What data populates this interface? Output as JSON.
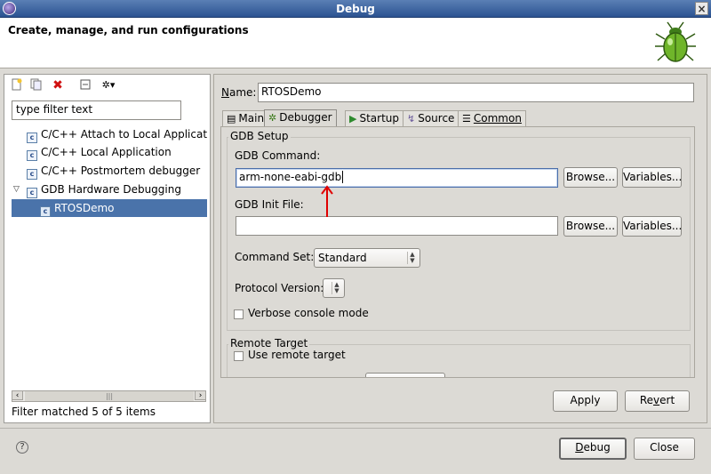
{
  "window": {
    "title": "Debug"
  },
  "banner": {
    "heading": "Create, manage, and run configurations"
  },
  "left": {
    "toolbar": [
      "new-config-icon",
      "duplicate-icon",
      "delete-icon",
      "collapse-all-icon",
      "filter-icon"
    ],
    "filter_value": "type filter text",
    "tree": [
      {
        "label": "C/C++ Attach to Local Applicatio",
        "level": 1
      },
      {
        "label": "C/C++ Local Application",
        "level": 1
      },
      {
        "label": "C/C++ Postmortem debugger",
        "level": 1
      },
      {
        "label": "GDB Hardware Debugging",
        "level": 1,
        "expanded": true
      },
      {
        "label": "RTOSDemo",
        "level": 2,
        "selected": true
      }
    ],
    "icon_letter": "c",
    "filter_status": "Filter matched 5 of 5 items"
  },
  "right": {
    "name_label_first": "N",
    "name_label_rest": "ame:",
    "name_value": "RTOSDemo",
    "tabs": [
      {
        "label": "Main",
        "icon": "▤"
      },
      {
        "label": "Debugger",
        "icon": "✲",
        "active": true
      },
      {
        "label": "Startup",
        "icon": "▶"
      },
      {
        "label": "Source",
        "icon": "↯"
      },
      {
        "label": "Common",
        "icon": "☰"
      }
    ],
    "gdb_setup": {
      "title": "GDB Setup",
      "command_label": "GDB Command:",
      "command_value": "arm-none-eabi-gdb",
      "browse": "Browse...",
      "variables": "Variables...",
      "init_label": "GDB Init File:",
      "init_value": "",
      "command_set_label": "Command Set:",
      "command_set_value": "Standard",
      "protocol_label": "Protocol Version:",
      "protocol_value": "",
      "verbose_label": "Verbose console mode",
      "verbose_checked": false
    },
    "remote": {
      "title": "Remote Target",
      "use_remote_label": "Use remote target",
      "use_remote_checked": false
    },
    "apply": "Apply",
    "revert_a": "Re",
    "revert_u": "v",
    "revert_b": "ert"
  },
  "footer": {
    "help_icon": "?",
    "debug_u": "D",
    "debug_rest": "ebug",
    "close": "Close"
  },
  "colors": {
    "selection": "#4a73aa",
    "annotation_arrow": "#e00000",
    "titlebar": "#2b5391"
  }
}
